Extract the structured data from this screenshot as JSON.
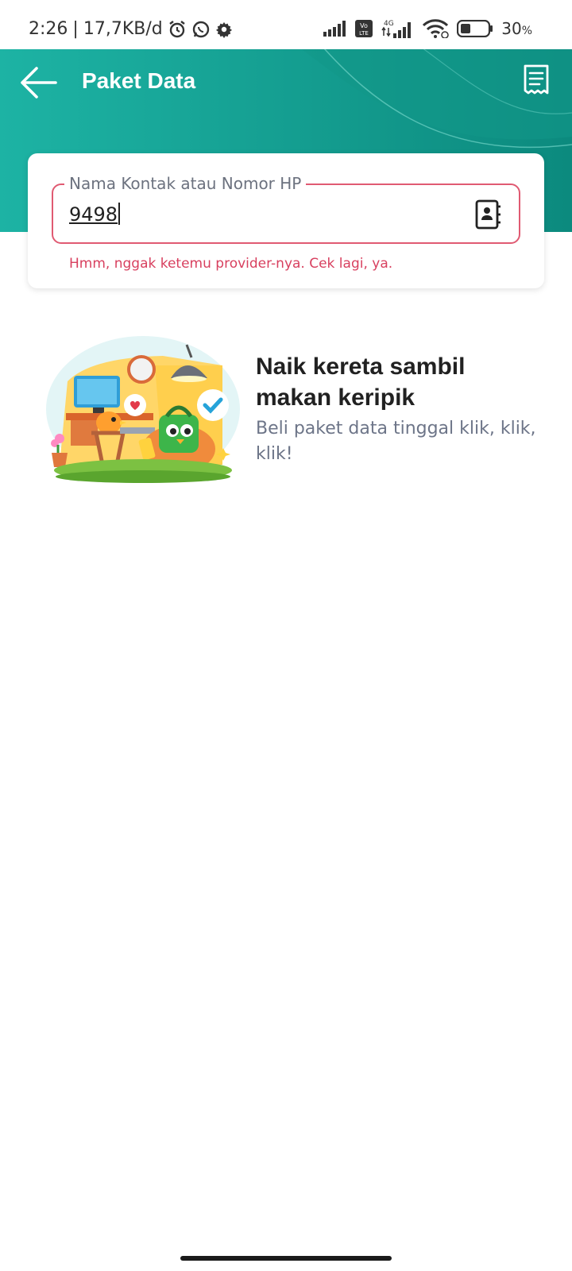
{
  "status_bar": {
    "time": "2:26",
    "network_speed": "17,7KB/d",
    "battery_percent": "30",
    "battery_unit": "%",
    "icons": [
      "alarm-icon",
      "whatsapp-icon",
      "settings-gear-icon",
      "signal-icon",
      "volte-icon",
      "4g-signal-icon",
      "wifi-icon",
      "battery-icon"
    ]
  },
  "header": {
    "title": "Paket Data",
    "back_icon": "arrow-left-icon",
    "history_icon": "receipt-icon",
    "colors": {
      "start": "#1aa89c",
      "end": "#0d8a7e"
    }
  },
  "phone_input": {
    "label": "Nama Kontak atau Nomor HP",
    "value": "9498",
    "contact_icon": "contact-book-icon",
    "error": "Hmm, nggak ketemu provider-nya. Cek lagi, ya.",
    "error_color": "#d8405f"
  },
  "promo": {
    "title": "Naik kereta sambil makan keripik",
    "subtitle": "Beli paket data tinggal klik, klik, klik!"
  }
}
